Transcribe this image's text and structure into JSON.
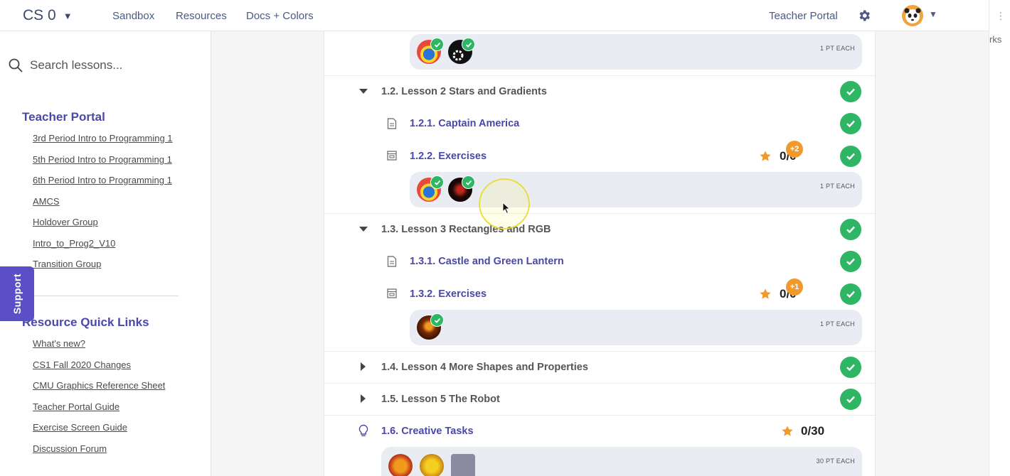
{
  "nav": {
    "brand": "CS 0",
    "links": [
      "Sandbox",
      "Resources",
      "Docs + Colors"
    ],
    "teacher_portal": "Teacher Portal"
  },
  "right_strip": {
    "text": "rks"
  },
  "sidebar": {
    "search_placeholder": "Search lessons...",
    "teacher_portal_title": "Teacher Portal",
    "teacher_links": [
      "3rd Period Intro to Programming 1",
      "5th Period Intro to Programming 1",
      "6th Period Intro to Programming 1",
      "AMCS",
      "Holdover Group",
      "Intro_to_Prog2_V10",
      "Transition Group"
    ],
    "resource_title": "Resource Quick Links",
    "resource_links": [
      "What's new?",
      "CS1 Fall 2020 Changes",
      "CMU Graphics Reference Sheet",
      "Teacher Portal Guide",
      "Exercise Screen Guide",
      "Discussion Forum"
    ],
    "support_label": "Support"
  },
  "content": {
    "pt_each": "1 PT EACH",
    "pt_each_30": "30 PT EACH",
    "lesson_1_2": "1.2. Lesson 2 Stars and Gradients",
    "item_1_2_1": "1.2.1. Captain America",
    "item_1_2_2": "1.2.2. Exercises",
    "score_1_2_2": "0/0",
    "badge_1_2_2": "+2",
    "lesson_1_3": "1.3. Lesson 3 Rectangles and RGB",
    "item_1_3_1": "1.3.1. Castle and Green Lantern",
    "item_1_3_2": "1.3.2. Exercises",
    "score_1_3_2": "0/0",
    "badge_1_3_2": "+1",
    "lesson_1_4": "1.4. Lesson 4 More Shapes and Properties",
    "lesson_1_5": "1.5. Lesson 5 The Robot",
    "item_1_6": "1.6. Creative Tasks",
    "score_1_6": "0/30"
  },
  "colors": {
    "accent": "#4a48a8",
    "success": "#2eb665",
    "star": "#f0992d",
    "support": "#5b4fc8"
  }
}
